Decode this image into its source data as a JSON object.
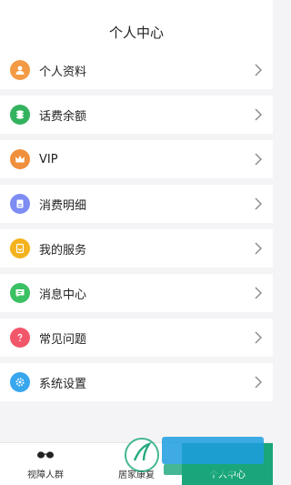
{
  "header": {
    "title": "个人中心"
  },
  "menu": [
    {
      "label": "个人资料",
      "icon": "user-icon",
      "color": "#f39a45"
    },
    {
      "label": "话费余额",
      "icon": "coins-icon",
      "color": "#33b35f"
    },
    {
      "label": "VIP",
      "icon": "crown-icon",
      "color": "#f0903d"
    },
    {
      "label": "消费明细",
      "icon": "receipt-icon",
      "color": "#7d8df3"
    },
    {
      "label": "我的服务",
      "icon": "service-icon",
      "color": "#f3b21e"
    },
    {
      "label": "消息中心",
      "icon": "message-icon",
      "color": "#3cc064"
    },
    {
      "label": "常见问题",
      "icon": "question-icon",
      "color": "#f2566a"
    },
    {
      "label": "系统设置",
      "icon": "settings-icon",
      "color": "#38a7ee"
    }
  ],
  "tabs": [
    {
      "label": "视障人群",
      "icon": "glasses-icon"
    },
    {
      "label": "居家康复",
      "icon": "home-rehab-icon"
    },
    {
      "label": "个人中心",
      "icon": "person-icon",
      "active": true
    }
  ],
  "colors": {
    "accent": "#1aa67a",
    "background": "#f4f4f6"
  }
}
